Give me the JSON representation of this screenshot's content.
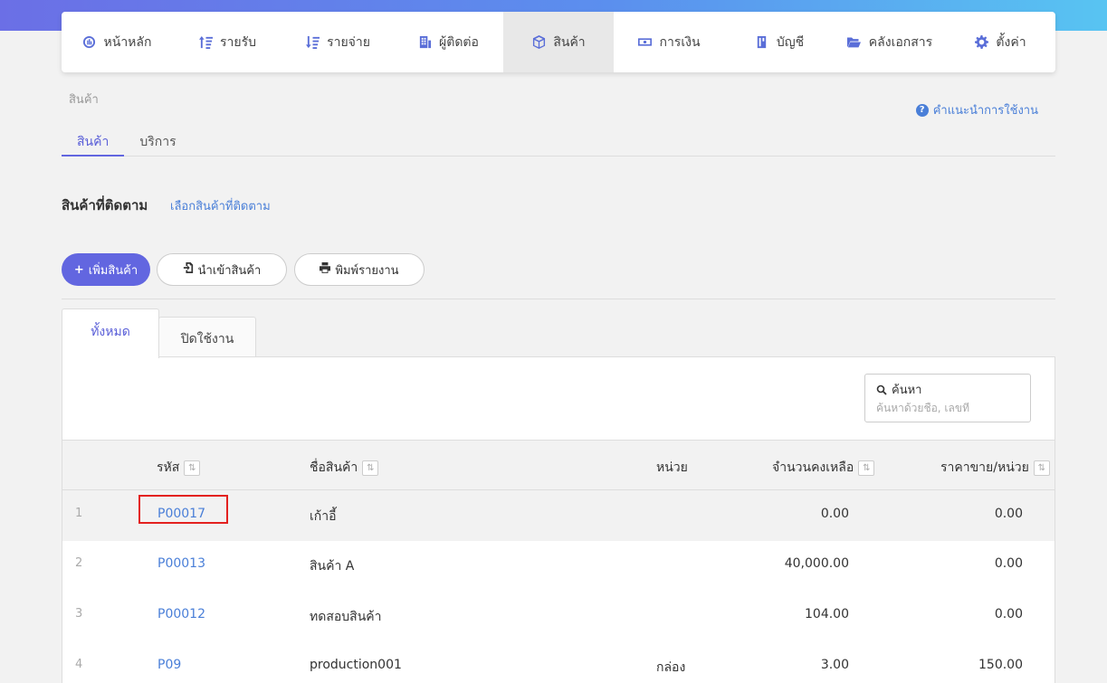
{
  "nav": {
    "items": [
      {
        "label": "หน้าหลัก",
        "icon": "dashboard-icon"
      },
      {
        "label": "รายรับ",
        "icon": "sort-amount-icon"
      },
      {
        "label": "รายจ่าย",
        "icon": "sort-amount-icon"
      },
      {
        "label": "ผู้ติดต่อ",
        "icon": "building-icon"
      },
      {
        "label": "สินค้า",
        "icon": "cube-icon",
        "active": true
      },
      {
        "label": "การเงิน",
        "icon": "money-icon"
      },
      {
        "label": "บัญชี",
        "icon": "book-icon"
      },
      {
        "label": "คลังเอกสาร",
        "icon": "folder-open-icon"
      },
      {
        "label": "ตั้งค่า",
        "icon": "gear-icon"
      }
    ]
  },
  "breadcrumb": "สินค้า",
  "help_link": "คำแนะนำการใช้งาน",
  "subtabs": [
    "สินค้า",
    "บริการ"
  ],
  "tracked": {
    "title": "สินค้าที่ติดตาม",
    "link": "เลือกสินค้าที่ติดตาม"
  },
  "actions": {
    "add": "เพิ่มสินค้า",
    "import": "นำเข้าสินค้า",
    "print": "พิมพ์รายงาน"
  },
  "panel_tabs": {
    "all": "ทั้งหมด",
    "disabled": "ปิดใช้งาน"
  },
  "search": {
    "label": "ค้นหา",
    "placeholder": "ค้นหาด้วยชื่อ, เลขที่"
  },
  "table": {
    "headers": {
      "code": "รหัส",
      "name": "ชื่อสินค้า",
      "unit": "หน่วย",
      "stock": "จำนวนคงเหลือ",
      "price": "ราคาขาย/หน่วย"
    },
    "rows": [
      {
        "num": "1",
        "code": "P00017",
        "name": "เก้าอี้",
        "unit": "",
        "stock": "0.00",
        "price": "0.00"
      },
      {
        "num": "2",
        "code": "P00013",
        "name": "สินค้า A",
        "unit": "",
        "stock": "40,000.00",
        "price": "0.00"
      },
      {
        "num": "3",
        "code": "P00012",
        "name": "ทดสอบสินค้า",
        "unit": "",
        "stock": "104.00",
        "price": "0.00"
      },
      {
        "num": "4",
        "code": "P09",
        "name": "production001",
        "unit": "กล่อง",
        "stock": "3.00",
        "price": "150.00"
      }
    ]
  },
  "colors": {
    "accent": "#6266e0",
    "link": "#4a7fd8",
    "highlight": "#e3211f"
  }
}
